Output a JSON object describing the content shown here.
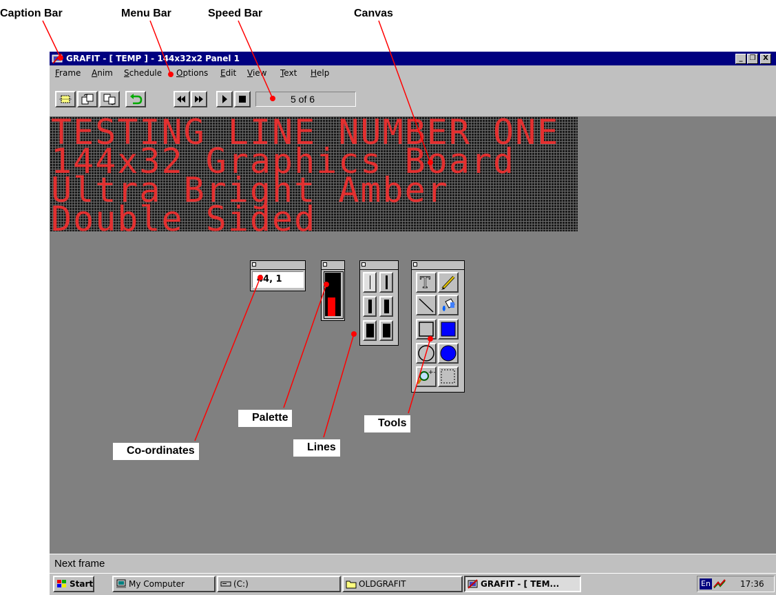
{
  "callouts": {
    "caption_bar": "Caption Bar",
    "menu_bar": "Menu Bar",
    "speed_bar": "Speed Bar",
    "canvas": "Canvas",
    "palette": "Palette",
    "tools": "Tools",
    "lines": "Lines",
    "coordinates": "Co-ordinates"
  },
  "window": {
    "title": "GRAFIT - [ TEMP ] - 144x32x2 Panel 1",
    "controls": [
      "_",
      "❒",
      "X"
    ]
  },
  "menu": [
    "Frame",
    "Anim",
    "Schedule",
    "Options",
    "Edit",
    "View",
    "Text",
    "Help"
  ],
  "speedbar": {
    "frame_counter": "5 of 6"
  },
  "canvas": {
    "lines": [
      "TESTING LINE NUMBER ONE",
      "144x32 Graphics Board",
      "Ultra Bright Amber",
      "Double Sided"
    ],
    "led_color": "#e33030"
  },
  "coordinates": {
    "value": "44, 1"
  },
  "palette": {
    "foreground": "#000000",
    "background": "#ff0000"
  },
  "tools": [
    "text-tool",
    "pencil-tool",
    "line-tool",
    "fill-tool",
    "rectangle-tool",
    "filled-rectangle-tool",
    "ellipse-tool",
    "filled-ellipse-tool",
    "zoom-tool",
    "select-tool"
  ],
  "status": {
    "text": "Next frame"
  },
  "taskbar": {
    "start": "Start",
    "items": [
      "My Computer",
      "(C:)",
      "OLDGRAFIT",
      "GRAFIT - [ TEM..."
    ],
    "lang": "En",
    "clock": "17:36"
  }
}
